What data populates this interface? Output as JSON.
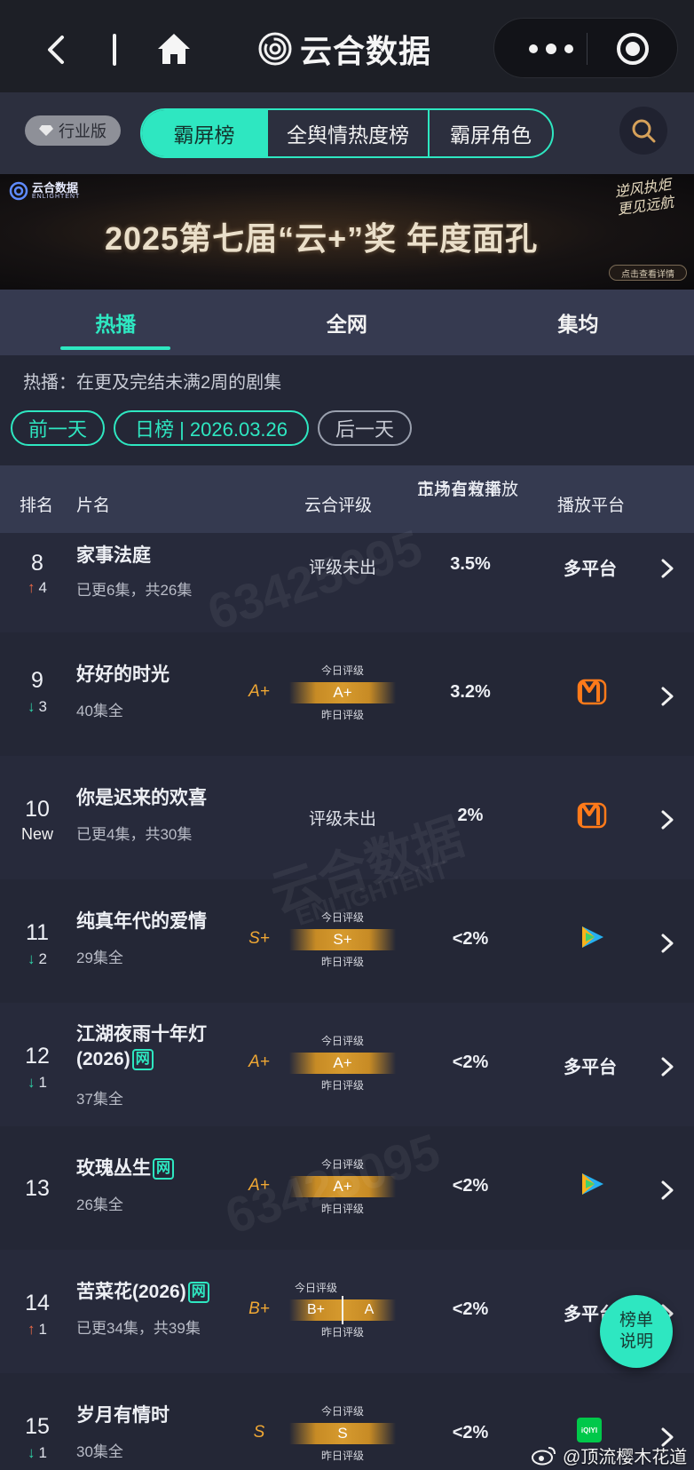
{
  "app": {
    "title": "云合数据"
  },
  "subbar": {
    "industry_label": "行业版",
    "segments": [
      "霸屏榜",
      "全舆情热度榜",
      "霸屏角色"
    ]
  },
  "banner": {
    "logo_cn": "云合数据",
    "logo_en": "ENLIGHTENT",
    "title": "2025第七届“云+”奖  年度面孔",
    "slogan": "逆风执炬 更见远航",
    "cta": "点击查看详情"
  },
  "tabs": [
    "热播",
    "全网",
    "集均"
  ],
  "description": "热播：在更及完结未满2周的剧集",
  "date_nav": {
    "prev": "前一天",
    "current": "日榜 | 2026.03.26",
    "next": "后一天"
  },
  "table": {
    "headers": {
      "rank": "排名",
      "name": "片名",
      "grade": "云合评级",
      "share": "正片有效播放市场占有率",
      "share_line1": "正片有效播放",
      "share_line2": "市场占有率",
      "platform": "播放平台"
    },
    "grade_today_label": "今日评级",
    "grade_yesterday_label": "昨日评级",
    "rows": [
      {
        "rank": "8",
        "trend": "up",
        "delta": "4",
        "title": "家事法庭",
        "episodes": "已更6集，共26集",
        "grade_text": "评级未出",
        "share": "3.5%",
        "platform": "多平台"
      },
      {
        "rank": "9",
        "trend": "down",
        "delta": "3",
        "title": "好好的时光",
        "episodes": "40集全",
        "grade": "A+",
        "grade_today": "A+",
        "share": "3.2%",
        "platform_icon": "mango-tv-icon"
      },
      {
        "rank": "10",
        "trend": "new",
        "delta": "New",
        "title": "你是迟来的欢喜",
        "episodes": "已更4集，共30集",
        "grade_text": "评级未出",
        "share": "2%",
        "platform_icon": "mango-tv-icon"
      },
      {
        "rank": "11",
        "trend": "down",
        "delta": "2",
        "title": "纯真年代的爱情",
        "episodes": "29集全",
        "grade": "S+",
        "grade_today": "S+",
        "share": "<2%",
        "platform_icon": "tencent-video-icon"
      },
      {
        "rank": "12",
        "trend": "down",
        "delta": "1",
        "title_line1": "江湖夜雨十年灯",
        "title_line2": "(2026)",
        "tag": "网",
        "episodes": "37集全",
        "grade": "A+",
        "grade_today": "A+",
        "share": "<2%",
        "platform": "多平台"
      },
      {
        "rank": "13",
        "trend": "none",
        "delta": "",
        "title": "玫瑰丛生",
        "tag": "网",
        "episodes": "26集全",
        "grade": "A+",
        "grade_today": "A+",
        "share": "<2%",
        "platform_icon": "tencent-video-icon"
      },
      {
        "rank": "14",
        "trend": "up",
        "delta": "1",
        "title": "苦菜花(2026)",
        "tag": "网",
        "episodes": "已更34集，共39集",
        "grade": "B+",
        "grade_today": "B+",
        "grade_yesterday": "A",
        "share": "<2%",
        "platform": "多平台"
      },
      {
        "rank": "15",
        "trend": "down",
        "delta": "1",
        "title": "岁月有情时",
        "episodes": "30集全",
        "grade": "S",
        "grade_today": "S",
        "share": "<2%",
        "platform_icon": "iqiyi-icon",
        "platform_icon_text": "iQIYI"
      }
    ]
  },
  "watermark": {
    "id": "63425095",
    "brand": "云合数据",
    "brand_en": "ENLIGHTENT"
  },
  "float_button": {
    "line1": "榜单",
    "line2": "说明"
  },
  "credit": "@顶流樱木花道",
  "colors": {
    "accent": "#2ee7c1",
    "up": "#f06a46",
    "down": "#30d3a8",
    "grade_gold": "#f0a834"
  }
}
